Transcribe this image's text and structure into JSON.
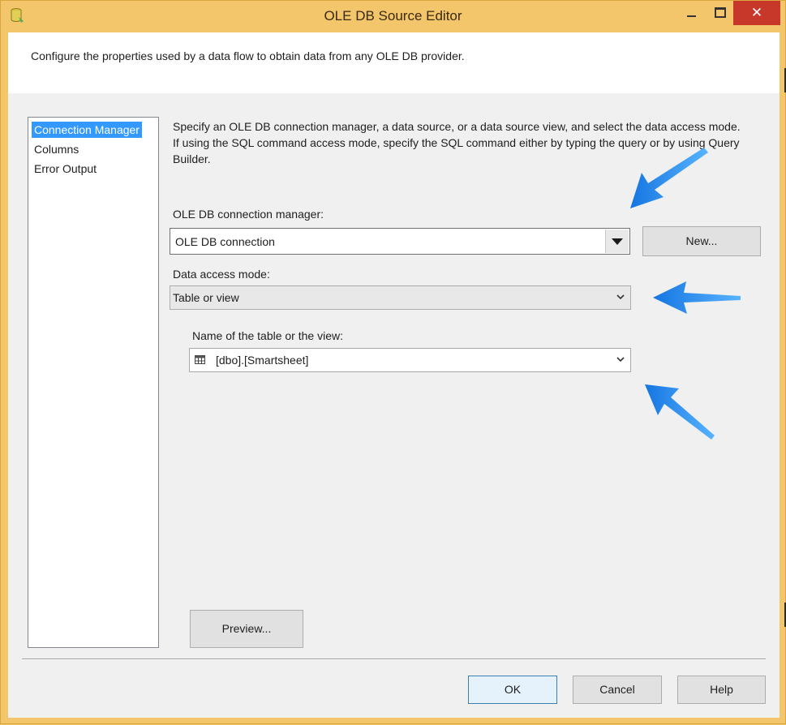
{
  "window": {
    "title": "OLE DB Source Editor",
    "close_glyph": "✕"
  },
  "header": {
    "description": "Configure the properties used by a data flow to obtain data from any OLE DB provider."
  },
  "nav": {
    "items": [
      {
        "label": "Connection Manager",
        "selected": true
      },
      {
        "label": "Columns",
        "selected": false
      },
      {
        "label": "Error Output",
        "selected": false
      }
    ]
  },
  "main": {
    "instructions": "Specify an OLE DB connection manager, a data source, or a data source view, and select the data access mode. If using the SQL command access mode, specify the SQL command either by typing the query or by using Query Builder.",
    "connection_label": "OLE DB connection manager:",
    "connection_value": "OLE DB connection",
    "new_button": "New...",
    "access_mode_label": "Data access mode:",
    "access_mode_value": "Table or view",
    "table_label": "Name of the table or the view:",
    "table_value": "[dbo].[Smartsheet]",
    "preview_button": "Preview..."
  },
  "footer": {
    "ok_button": "OK",
    "cancel_button": "Cancel",
    "help_button": "Help"
  },
  "colors": {
    "title_bar": "#f3c66b",
    "close_button": "#c7382b",
    "selection": "#3399ff",
    "annotation_arrow": "#1a8cff"
  },
  "icons": [
    "database-icon",
    "minimize-icon",
    "maximize-icon",
    "close-icon",
    "dropdown-arrow-icon",
    "table-icon",
    "chevron-down-icon",
    "annotation-arrow-icon"
  ]
}
